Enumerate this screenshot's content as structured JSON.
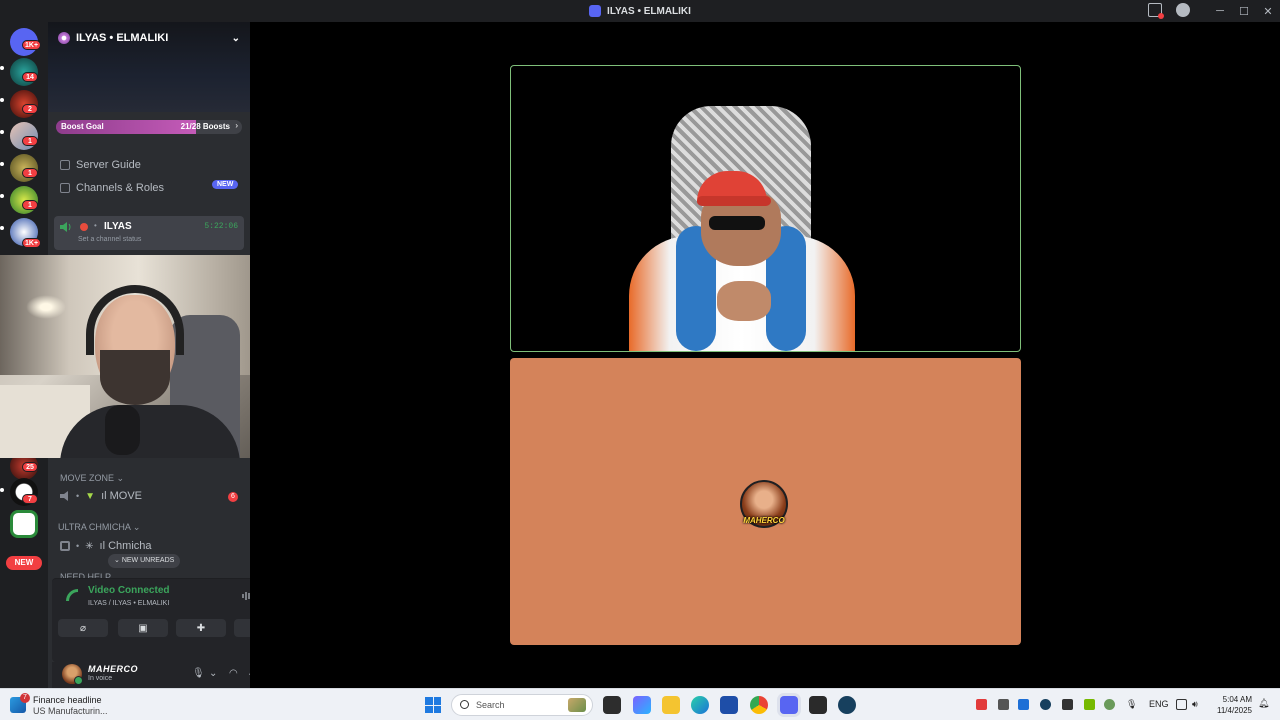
{
  "window": {
    "title": "ILYAS • ELMALIKI"
  },
  "rail": {
    "badges": [
      "1K+",
      "14",
      "2",
      "1",
      "1",
      "1",
      "1K+",
      "25",
      "7"
    ],
    "new_label": "NEW"
  },
  "server": {
    "name": "ILYAS • ELMALIKI",
    "boost": {
      "label": "Boost Goal",
      "count": "21/28 Boosts",
      "progress": 0.75
    },
    "nav": {
      "guide": "Server Guide",
      "roles": "Channels & Roles",
      "roles_badge": "NEW"
    },
    "active_channel": {
      "name": "ILYAS",
      "timer": "5:22:06",
      "status": "Set a channel status"
    },
    "categories": {
      "move_zone": "MOVE ZONE",
      "move_channel": "ıl MOVE",
      "move_badge": "6",
      "ultra": "ULTRA CHMICHA",
      "chmicha_channel": "ıl Chmicha",
      "need_help": "NEED HELP"
    },
    "new_unreads": "NEW UNREADS"
  },
  "voice": {
    "status": "Video Connected",
    "location": "ILYAS / ILYAS • ELMALIKI"
  },
  "user": {
    "name": "MAHERCO",
    "status": "In voice"
  },
  "stage": {
    "bottom_tile_label": "MAHERCO"
  },
  "taskbar": {
    "news_count": "7",
    "news_title": "Finance headline",
    "news_sub": "US Manufacturin...",
    "search_placeholder": "Search",
    "lang": "ENG",
    "time": "5:04 AM",
    "date": "11/4/2025"
  },
  "colors": {
    "accent": "#5865f2",
    "voice_green": "#3ba55c",
    "speaking_border": "#7fbf7a",
    "tile_bg": "#d4835a",
    "alert": "#f23f42"
  }
}
